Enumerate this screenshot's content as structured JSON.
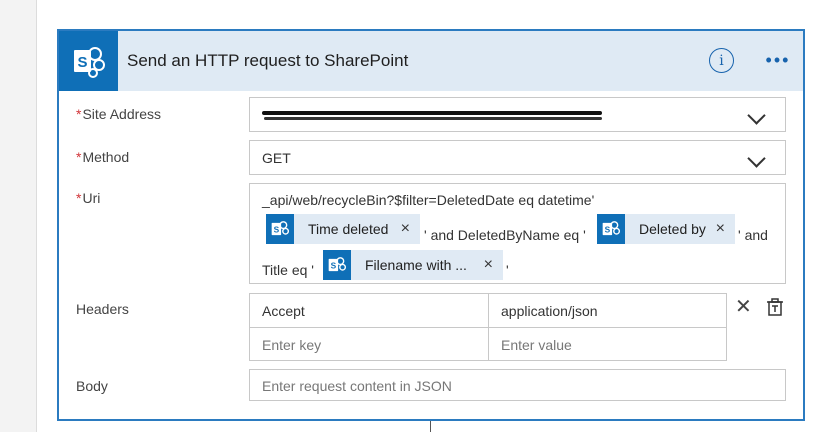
{
  "card": {
    "title": "Send an HTTP request to SharePoint",
    "info_icon": "info-icon",
    "more_icon": "ellipsis-icon",
    "logo_icon": "sharepoint-icon",
    "logo_letter": "S"
  },
  "fields": {
    "site_address": {
      "label": "Site Address",
      "required": "*",
      "value_icon": "redacted"
    },
    "method": {
      "label": "Method",
      "required": "*",
      "value": "GET"
    },
    "uri": {
      "label": "Uri",
      "required": "*",
      "line1": "_api/web/recycleBin?$filter=DeletedDate eq datetime'",
      "tokens": [
        {
          "label": "Time deleted"
        },
        {
          "label": "Deleted by"
        },
        {
          "label": "Filename with ..."
        }
      ],
      "text_after_token1": "' and DeletedByName eq '",
      "text_after_token2": "' and",
      "text_before_token3": "Title eq '",
      "text_after_token3": "'"
    },
    "headers": {
      "label": "Headers",
      "rows": [
        {
          "key": "Accept",
          "value": "application/json"
        }
      ],
      "key_placeholder": "Enter key",
      "value_placeholder": "Enter value"
    },
    "body": {
      "label": "Body",
      "placeholder": "Enter request content in JSON"
    }
  },
  "colors": {
    "accent": "#2b7bc0",
    "brand": "#0f6fb7",
    "header_bg": "#dfeaf4",
    "required": "#d13438"
  }
}
